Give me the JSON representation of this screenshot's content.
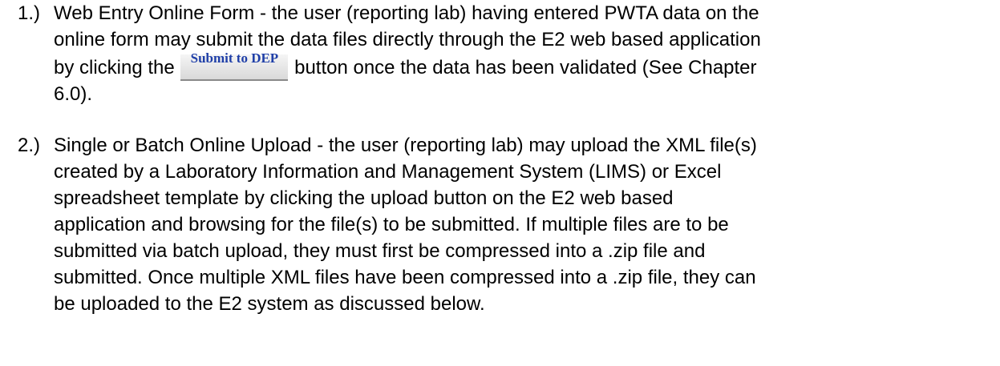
{
  "items": [
    {
      "number": "1.)",
      "lines": [
        "Web Entry Online Form - the user (reporting lab) having entered PWTA data on the",
        "online form may submit the data files directly through the E2 web based application"
      ],
      "button_line_before": "by clicking the",
      "button_label": "Submit to DEP",
      "button_line_after": "button once the data has been validated (See Chapter",
      "last_line": "6.0)."
    },
    {
      "number": "2.)",
      "lines": [
        "Single or Batch Online Upload - the user (reporting lab) may upload the XML file(s)",
        "created by a Laboratory Information and Management System (LIMS) or Excel",
        "spreadsheet template by clicking the upload button on the E2 web based",
        "application and browsing for the file(s) to be submitted. If multiple files are to be",
        "submitted via batch upload, they must first be compressed into a .zip file and",
        "submitted.  Once multiple XML files have been compressed into a .zip file, they can",
        "be uploaded to the E2 system as discussed below."
      ]
    }
  ]
}
